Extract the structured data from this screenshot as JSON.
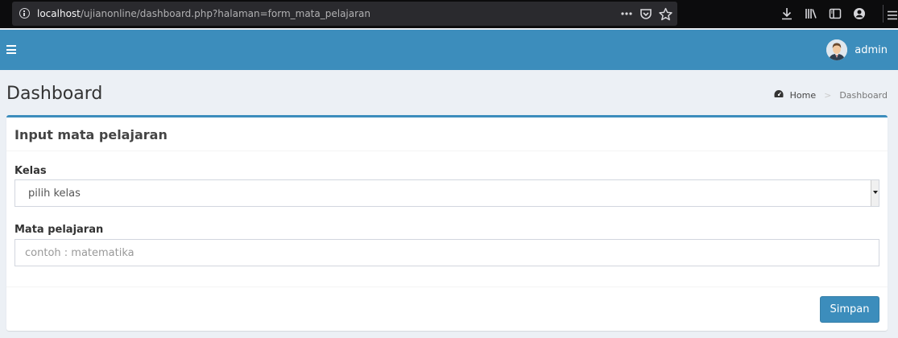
{
  "browser": {
    "url_host": "localhost",
    "url_path": "/ujianonline/dashboard.php?halaman=form_mata_pelajaran",
    "url_actions": [
      "more-icon",
      "pocket-icon",
      "bookmark-star-icon"
    ],
    "toolbar": [
      "download-icon",
      "library-icon",
      "sidebar-icon",
      "account-icon",
      "menu-icon"
    ]
  },
  "header": {
    "user_name": "admin",
    "accent_color": "#3c8dbc"
  },
  "page": {
    "title": "Dashboard",
    "breadcrumb": {
      "home": "Home",
      "current": "Dashboard"
    }
  },
  "form": {
    "title": "Input mata pelajaran",
    "kelas_label": "Kelas",
    "kelas_selected": "pilih kelas",
    "mapel_label": "Mata pelajaran",
    "mapel_placeholder": "contoh : matematika",
    "mapel_value": "",
    "submit_label": "Simpan"
  }
}
